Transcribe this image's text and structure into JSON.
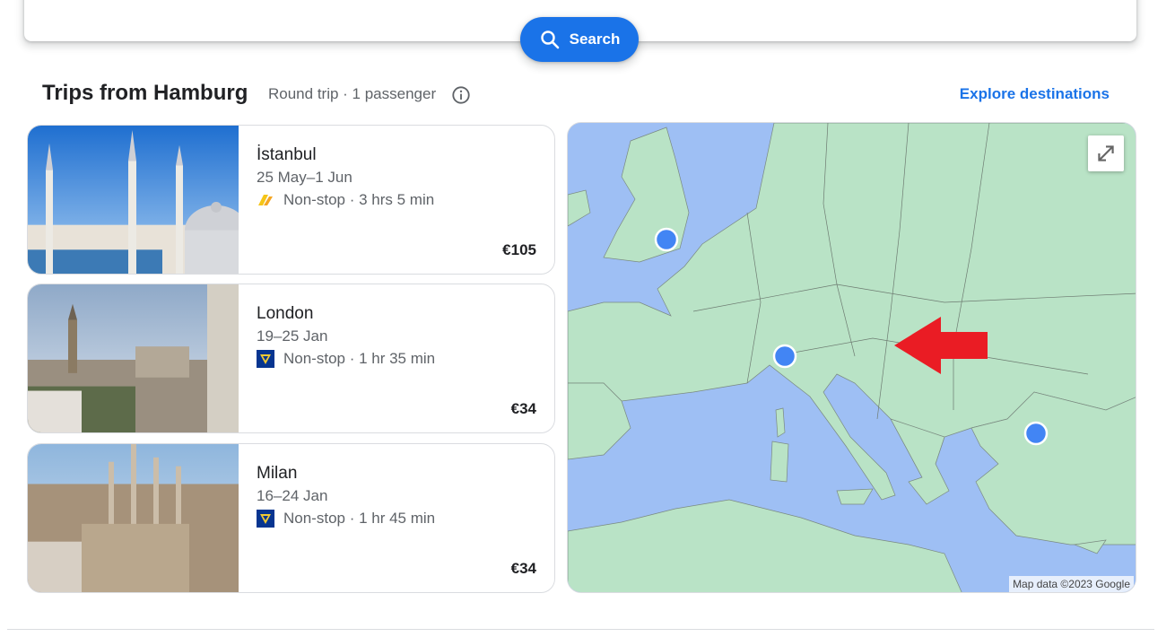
{
  "search": {
    "button_label": "Search",
    "icon": "search-icon"
  },
  "section": {
    "title": "Trips from Hamburg",
    "subtitle": "Round trip · 1 passenger",
    "info_icon": "info-icon",
    "explore_link": "Explore destinations"
  },
  "trips": [
    {
      "city": "İstanbul",
      "dates": "25 May–1 Jun",
      "flight": "Non-stop · 3 hrs 5 min",
      "price": "€105",
      "airline_icon": "pegasus-airline-icon"
    },
    {
      "city": "London",
      "dates": "19–25 Jan",
      "flight": "Non-stop · 1 hr 35 min",
      "price": "€34",
      "airline_icon": "ryanair-airline-icon"
    },
    {
      "city": "Milan",
      "dates": "16–24 Jan",
      "flight": "Non-stop · 1 hr 45 min",
      "price": "€34",
      "airline_icon": "ryanair-airline-icon"
    }
  ],
  "map": {
    "attribution": "Map data ©2023 Google",
    "fullscreen_icon": "fullscreen-icon",
    "markers": [
      "london-marker",
      "milan-marker",
      "istanbul-marker"
    ],
    "colors": {
      "land": "#b9e3c6",
      "water": "#9ebff4",
      "marker": "#4285f4",
      "arrow": "#ea1c24"
    }
  },
  "colors": {
    "accent": "#1a73e8",
    "text_secondary": "#5f6368",
    "border": "#dadce0"
  }
}
